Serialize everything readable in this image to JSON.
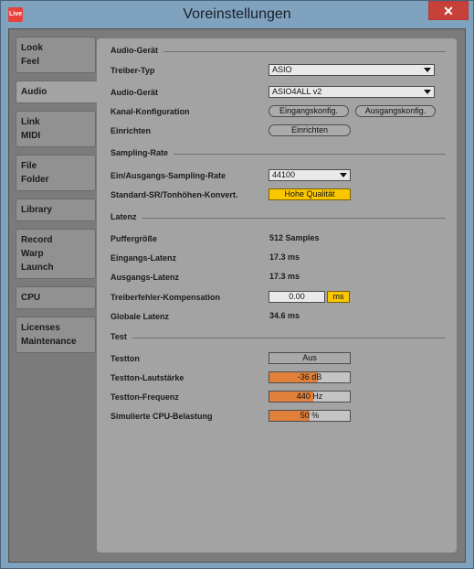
{
  "window": {
    "title": "Voreinstellungen",
    "app_icon_text": "Live",
    "close_symbol": "✕"
  },
  "sidebar": {
    "groups": [
      {
        "items": [
          "Look",
          "Feel"
        ]
      },
      {
        "items": [
          "Audio"
        ],
        "active": true
      },
      {
        "items": [
          "Link",
          "MIDI"
        ]
      },
      {
        "items": [
          "File",
          "Folder"
        ]
      },
      {
        "items": [
          "Library"
        ]
      },
      {
        "items": [
          "Record",
          "Warp",
          "Launch"
        ]
      },
      {
        "items": [
          "CPU"
        ]
      },
      {
        "items": [
          "Licenses",
          "Maintenance"
        ]
      }
    ]
  },
  "audio_device": {
    "section_title": "Audio-Gerät",
    "driver_type_label": "Treiber-Typ",
    "driver_type_value": "ASIO",
    "device_label": "Audio-Gerät",
    "device_value": "ASIO4ALL v2",
    "channel_config_label": "Kanal-Konfiguration",
    "input_config_button": "Eingangskonfig.",
    "output_config_button": "Ausgangskonfig.",
    "setup_label": "Einrichten",
    "setup_button": "Einrichten"
  },
  "sampling": {
    "section_title": "Sampling-Rate",
    "rate_label": "Ein/Ausgangs-Sampling-Rate",
    "rate_value": "44100",
    "conversion_label": "Standard-SR/Tonhöhen-Konvert.",
    "conversion_value": "Hohe Qualität"
  },
  "latency": {
    "section_title": "Latenz",
    "buffer_label": "Puffergröße",
    "buffer_value": "512 Samples",
    "input_latency_label": "Eingangs-Latenz",
    "input_latency_value": "17.3 ms",
    "output_latency_label": "Ausgangs-Latenz",
    "output_latency_value": "17.3 ms",
    "driver_comp_label": "Treiberfehler-Kompensation",
    "driver_comp_value": "0.00",
    "driver_comp_unit": "ms",
    "total_latency_label": "Globale Latenz",
    "total_latency_value": "34.6 ms"
  },
  "test": {
    "section_title": "Test",
    "tone_label": "Testton",
    "tone_value": "Aus",
    "volume_label": "Testton-Lautstärke",
    "volume_value": "-36 dB",
    "volume_fill_fraction": 0.6,
    "frequency_label": "Testton-Frequenz",
    "frequency_value": "440 Hz",
    "frequency_fill_fraction": 0.55,
    "cpu_label": "Simulierte CPU-Belastung",
    "cpu_value": "50 %",
    "cpu_fill_fraction": 0.5
  },
  "colors": {
    "accent_yellow": "#f9c600",
    "slider_orange": "#e0803a",
    "close_red": "#c7403a"
  }
}
